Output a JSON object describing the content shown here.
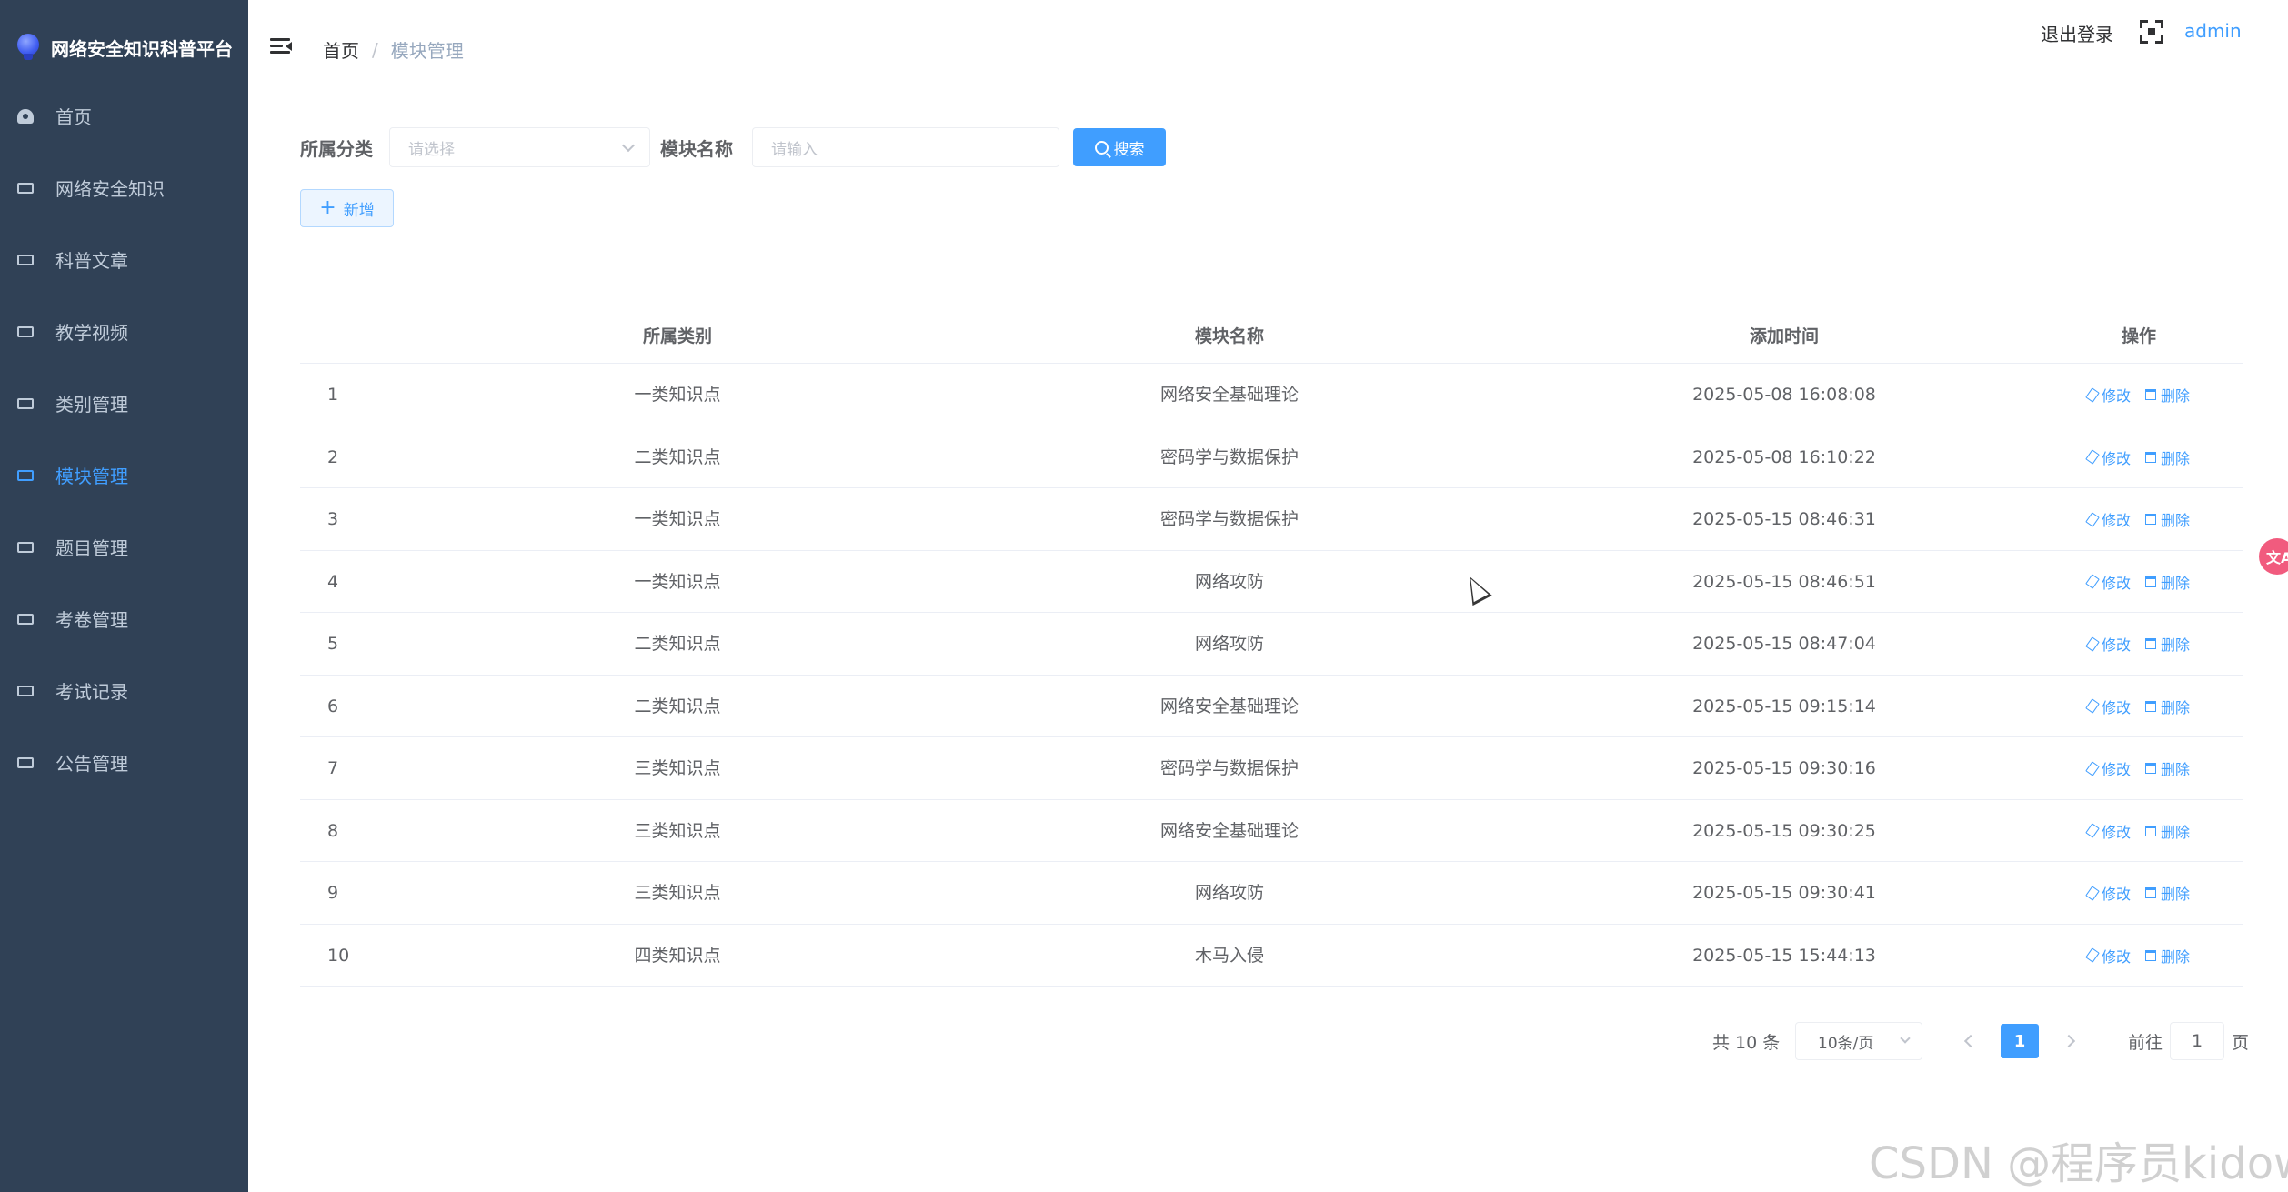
{
  "app": {
    "title": "网络安全知识科普平台"
  },
  "sidebar": {
    "items": [
      {
        "label": "首页",
        "icon": "dashboard-icon",
        "active": false
      },
      {
        "label": "网络安全知识",
        "icon": "menu-icon",
        "active": false
      },
      {
        "label": "科普文章",
        "icon": "menu-icon",
        "active": false
      },
      {
        "label": "教学视频",
        "icon": "menu-icon",
        "active": false
      },
      {
        "label": "类别管理",
        "icon": "menu-icon",
        "active": false
      },
      {
        "label": "模块管理",
        "icon": "menu-icon",
        "active": true
      },
      {
        "label": "题目管理",
        "icon": "menu-icon",
        "active": false
      },
      {
        "label": "考卷管理",
        "icon": "menu-icon",
        "active": false
      },
      {
        "label": "考试记录",
        "icon": "menu-icon",
        "active": false
      },
      {
        "label": "公告管理",
        "icon": "menu-icon",
        "active": false
      }
    ]
  },
  "navbar": {
    "breadcrumb": {
      "home": "首页",
      "separator": "/",
      "current": "模块管理"
    },
    "logout": "退出登录",
    "username": "admin"
  },
  "filters": {
    "category_label": "所属分类",
    "category_placeholder": "请选择",
    "module_label": "模块名称",
    "module_placeholder": "请输入",
    "search_button": "搜索",
    "add_button": "新增"
  },
  "table": {
    "columns": [
      "",
      "所属类别",
      "模块名称",
      "添加时间",
      "操作"
    ],
    "edit_label": "修改",
    "delete_label": "删除",
    "rows": [
      {
        "index": "1",
        "category": "一类知识点",
        "name": "网络安全基础理论",
        "time": "2025-05-08 16:08:08"
      },
      {
        "index": "2",
        "category": "二类知识点",
        "name": "密码学与数据保护",
        "time": "2025-05-08 16:10:22"
      },
      {
        "index": "3",
        "category": "一类知识点",
        "name": "密码学与数据保护",
        "time": "2025-05-15 08:46:31"
      },
      {
        "index": "4",
        "category": "一类知识点",
        "name": "网络攻防",
        "time": "2025-05-15 08:46:51"
      },
      {
        "index": "5",
        "category": "二类知识点",
        "name": "网络攻防",
        "time": "2025-05-15 08:47:04"
      },
      {
        "index": "6",
        "category": "二类知识点",
        "name": "网络安全基础理论",
        "time": "2025-05-15 09:15:14"
      },
      {
        "index": "7",
        "category": "三类知识点",
        "name": "密码学与数据保护",
        "time": "2025-05-15 09:30:16"
      },
      {
        "index": "8",
        "category": "三类知识点",
        "name": "网络安全基础理论",
        "time": "2025-05-15 09:30:25"
      },
      {
        "index": "9",
        "category": "三类知识点",
        "name": "网络攻防",
        "time": "2025-05-15 09:30:41"
      },
      {
        "index": "10",
        "category": "四类知识点",
        "name": "木马入侵",
        "time": "2025-05-15 15:44:13"
      }
    ]
  },
  "pagination": {
    "total": "共 10 条",
    "page_size": "10条/页",
    "current_page": "1",
    "goto_prefix": "前往",
    "goto_value": "1",
    "goto_suffix": "页"
  },
  "watermark": "CSDN @程序员kidow",
  "colors": {
    "sidebar_bg": "#304156",
    "accent": "#409eff",
    "sidebar_text": "#bfcbd9"
  }
}
